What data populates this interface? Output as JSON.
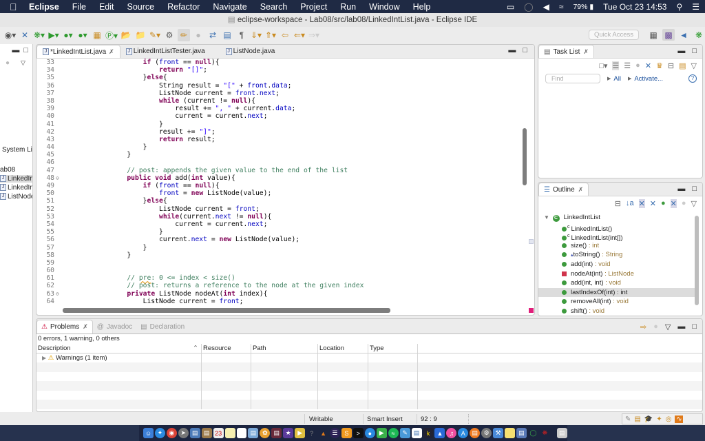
{
  "menubar": {
    "app_name": "Eclipse",
    "items": [
      "File",
      "Edit",
      "Source",
      "Refactor",
      "Navigate",
      "Search",
      "Project",
      "Run",
      "Window",
      "Help"
    ],
    "battery": "79%",
    "datetime": "Tue Oct 23  14:53",
    "icons": [
      "airplay-icon",
      "siri-icon",
      "volume-icon",
      "wifi-icon",
      "battery-icon",
      "spotlight-icon",
      "notification-center-icon"
    ]
  },
  "window": {
    "title": "eclipse-workspace - Lab08/src/lab08/LinkedIntList.java - Eclipse IDE"
  },
  "toolbar": {
    "quick_access_placeholder": "Quick Access"
  },
  "package_explorer": {
    "items": [
      {
        "label": "System Lil",
        "selected": false
      },
      {
        "label": "ab08",
        "selected": false
      },
      {
        "label": "LinkedIn",
        "selected": true
      },
      {
        "label": "LinkedIn",
        "selected": false
      },
      {
        "label": "ListNode",
        "selected": false
      }
    ]
  },
  "editor": {
    "tabs": [
      {
        "label": "*LinkedIntList.java",
        "active": true,
        "closable": true
      },
      {
        "label": "LinkedIntListTester.java",
        "active": false
      },
      {
        "label": "ListNode.java",
        "active": false
      }
    ],
    "lines": [
      {
        "n": "33",
        "code": "        if (front == null){"
      },
      {
        "n": "34",
        "code": "            return \"[]\";"
      },
      {
        "n": "35",
        "code": "        }else{"
      },
      {
        "n": "36",
        "code": "            String result = \"[\" + front.data;"
      },
      {
        "n": "37",
        "code": "            ListNode current = front.next;"
      },
      {
        "n": "38",
        "code": "            while (current != null){"
      },
      {
        "n": "39",
        "code": "                result += \", \" + current.data;"
      },
      {
        "n": "40",
        "code": "                current = current.next;"
      },
      {
        "n": "41",
        "code": "            }"
      },
      {
        "n": "42",
        "code": "            result += \"]\";"
      },
      {
        "n": "43",
        "code": "            return result;"
      },
      {
        "n": "44",
        "code": "        }"
      },
      {
        "n": "45",
        "code": "    }"
      },
      {
        "n": "46",
        "code": ""
      },
      {
        "n": "47",
        "code": "    // post: appends the given value to the end of the list"
      },
      {
        "n": "48",
        "code": "    public void add(int value){",
        "fold": true
      },
      {
        "n": "49",
        "code": "        if (front == null){"
      },
      {
        "n": "50",
        "code": "            front = new ListNode(value);"
      },
      {
        "n": "51",
        "code": "        }else{"
      },
      {
        "n": "52",
        "code": "            ListNode current = front;"
      },
      {
        "n": "53",
        "code": "            while(current.next != null){"
      },
      {
        "n": "54",
        "code": "                current = current.next;"
      },
      {
        "n": "55",
        "code": "            }"
      },
      {
        "n": "56",
        "code": "            current.next = new ListNode(value);"
      },
      {
        "n": "57",
        "code": "        }"
      },
      {
        "n": "58",
        "code": "    }"
      },
      {
        "n": "59",
        "code": ""
      },
      {
        "n": "60",
        "code": ""
      },
      {
        "n": "61",
        "code": "    // pre: 0 <= index < size()"
      },
      {
        "n": "62",
        "code": "    // post: returns a reference to the node at the given index"
      },
      {
        "n": "63",
        "code": "    private ListNode nodeAt(int index){",
        "fold": true
      },
      {
        "n": "64",
        "code": "        ListNode current = front;"
      }
    ],
    "vscroll_position": 0.28,
    "vscroll_visible_fraction": 0.23,
    "hscroll_visible_fraction": 0.85
  },
  "task_list": {
    "title": "Task List",
    "find_placeholder": "Find",
    "filter_all": "All",
    "activate": "Activate...",
    "help": "?"
  },
  "outline": {
    "title": "Outline",
    "root": "LinkedIntList",
    "items": [
      {
        "name": "LinkedIntList()",
        "type": "",
        "visibility": "public",
        "constructor": true
      },
      {
        "name": "LinkedIntList(int[])",
        "type": "",
        "visibility": "public",
        "constructor": true
      },
      {
        "name": "size()",
        "type": " : int",
        "visibility": "public"
      },
      {
        "name": "toString()",
        "type": " : String",
        "visibility": "public",
        "override": true
      },
      {
        "name": "add(int)",
        "type": " : void",
        "visibility": "public"
      },
      {
        "name": "nodeAt(int)",
        "type": " : ListNode",
        "visibility": "private"
      },
      {
        "name": "add(int, int)",
        "type": " : void",
        "visibility": "public"
      },
      {
        "name": "lastIndexOf(int)",
        "type": " : int",
        "visibility": "public",
        "selected": true
      },
      {
        "name": "removeAll(int)",
        "type": " : void",
        "visibility": "public"
      },
      {
        "name": "shift()",
        "type": " : void",
        "visibility": "public"
      }
    ]
  },
  "problems": {
    "tabs": [
      {
        "label": "Problems",
        "active": true
      },
      {
        "label": "Javadoc",
        "active": false
      },
      {
        "label": "Declaration",
        "active": false
      }
    ],
    "summary": "0 errors, 1 warning, 0 others",
    "columns": [
      "Description",
      "Resource",
      "Path",
      "Location",
      "Type",
      ""
    ],
    "rows": [
      {
        "description": "Warnings (1 item)",
        "resource": "",
        "path": "",
        "location": "",
        "type": ""
      }
    ]
  },
  "statusbar": {
    "writable": "Writable",
    "insert_mode": "Smart Insert",
    "position": "92 : 9"
  },
  "colors": {
    "keyword": "#7f0055",
    "field": "#0000c0",
    "string": "#2a00ff",
    "comment": "#3f7f5f",
    "menubar_bg": "#1f2a44",
    "public_method": "#3d9a3d",
    "private_method": "#d0344c"
  }
}
